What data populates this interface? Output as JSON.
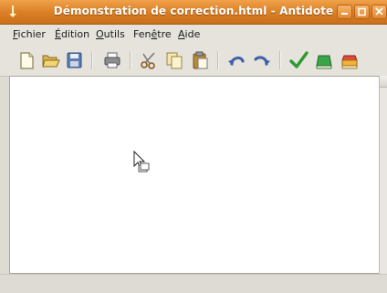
{
  "window": {
    "title": "Démonstration de correction.html - Antidote"
  },
  "menu": [
    {
      "mnemonic": "F",
      "rest": "ichier"
    },
    {
      "mnemonic": "É",
      "rest": "dition"
    },
    {
      "mnemonic": "O",
      "rest": "utils"
    },
    {
      "pre": "Fen",
      "mnemonic": "ê",
      "rest": "tre"
    },
    {
      "mnemonic": "A",
      "rest": "ide"
    }
  ],
  "colors": {
    "titlebar": "#d97e23",
    "background": "#dedbd5",
    "editor": "#ffffff"
  },
  "toolbar_icons": [
    "new-document-icon",
    "open-folder-icon",
    "save-icon",
    "print-icon",
    "cut-icon",
    "copy-icon",
    "paste-icon",
    "undo-icon",
    "redo-icon",
    "check-icon",
    "green-book-icon",
    "red-book-icon"
  ]
}
